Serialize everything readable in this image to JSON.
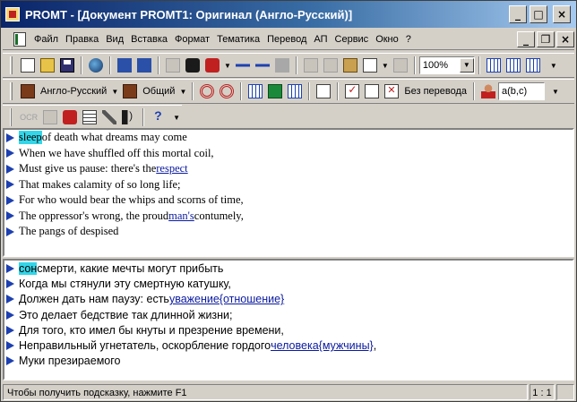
{
  "window": {
    "title": "PROMT - [Документ PROMT1: Оригинал (Англо-Русский)]",
    "minimize_glyph": "_",
    "maximize_glyph": "□",
    "close_glyph": "×"
  },
  "menu": {
    "items": [
      "Файл",
      "Правка",
      "Вид",
      "Вставка",
      "Формат",
      "Тематика",
      "Перевод",
      "АП",
      "Сервис",
      "Окно",
      "?"
    ],
    "mdi_minimize": "_",
    "mdi_restore": "❐",
    "mdi_close": "×"
  },
  "toolbar1": {
    "zoom": "100%"
  },
  "toolbar2": {
    "direction": "Англо-Русский",
    "topic": "Общий",
    "no_translate_label": "Без перевода",
    "format_value": "a(b,c)"
  },
  "toolbar3": {
    "ocr_label": "OCR"
  },
  "source": {
    "lines": [
      {
        "parts": [
          {
            "text": "sleep",
            "hl": true
          },
          {
            "text": " of death what dreams may come"
          }
        ]
      },
      {
        "parts": [
          {
            "text": "When we have shuffled off this mortal coil,"
          }
        ]
      },
      {
        "parts": [
          {
            "text": "Must give us pause: there's the "
          },
          {
            "text": "respect",
            "ul": true
          }
        ]
      },
      {
        "parts": [
          {
            "text": "That makes calamity of so long life;"
          }
        ]
      },
      {
        "parts": [
          {
            "text": "For who would bear the whips and scorns of time,"
          }
        ]
      },
      {
        "parts": [
          {
            "text": "The oppressor's wrong, the proud "
          },
          {
            "text": "man's",
            "ul": true
          },
          {
            "text": " contumely,"
          }
        ]
      },
      {
        "parts": [
          {
            "text": "The pangs of despised"
          }
        ]
      }
    ]
  },
  "target": {
    "lines": [
      {
        "parts": [
          {
            "text": "сон",
            "hl": true
          },
          {
            "text": " смерти, какие мечты могут прибыть"
          }
        ]
      },
      {
        "parts": [
          {
            "text": "Когда мы стянули эту смертную катушку,"
          }
        ]
      },
      {
        "parts": [
          {
            "text": "Должен дать нам паузу: есть "
          },
          {
            "text": "уважение{отношение}",
            "ul": true
          }
        ]
      },
      {
        "parts": [
          {
            "text": "Это делает бедствие так длинной жизни;"
          }
        ]
      },
      {
        "parts": [
          {
            "text": "Для того, кто имел бы кнуты и презрение времени,"
          }
        ]
      },
      {
        "parts": [
          {
            "text": "Неправильный угнетатель, оскорбление гордого "
          },
          {
            "text": "человека{мужчины}",
            "ul": true
          },
          {
            "text": ","
          }
        ]
      },
      {
        "parts": [
          {
            "text": "Муки презираемого"
          }
        ]
      }
    ]
  },
  "status": {
    "hint": "Чтобы получить подсказку, нажмите F1",
    "position": "1 : 1"
  }
}
